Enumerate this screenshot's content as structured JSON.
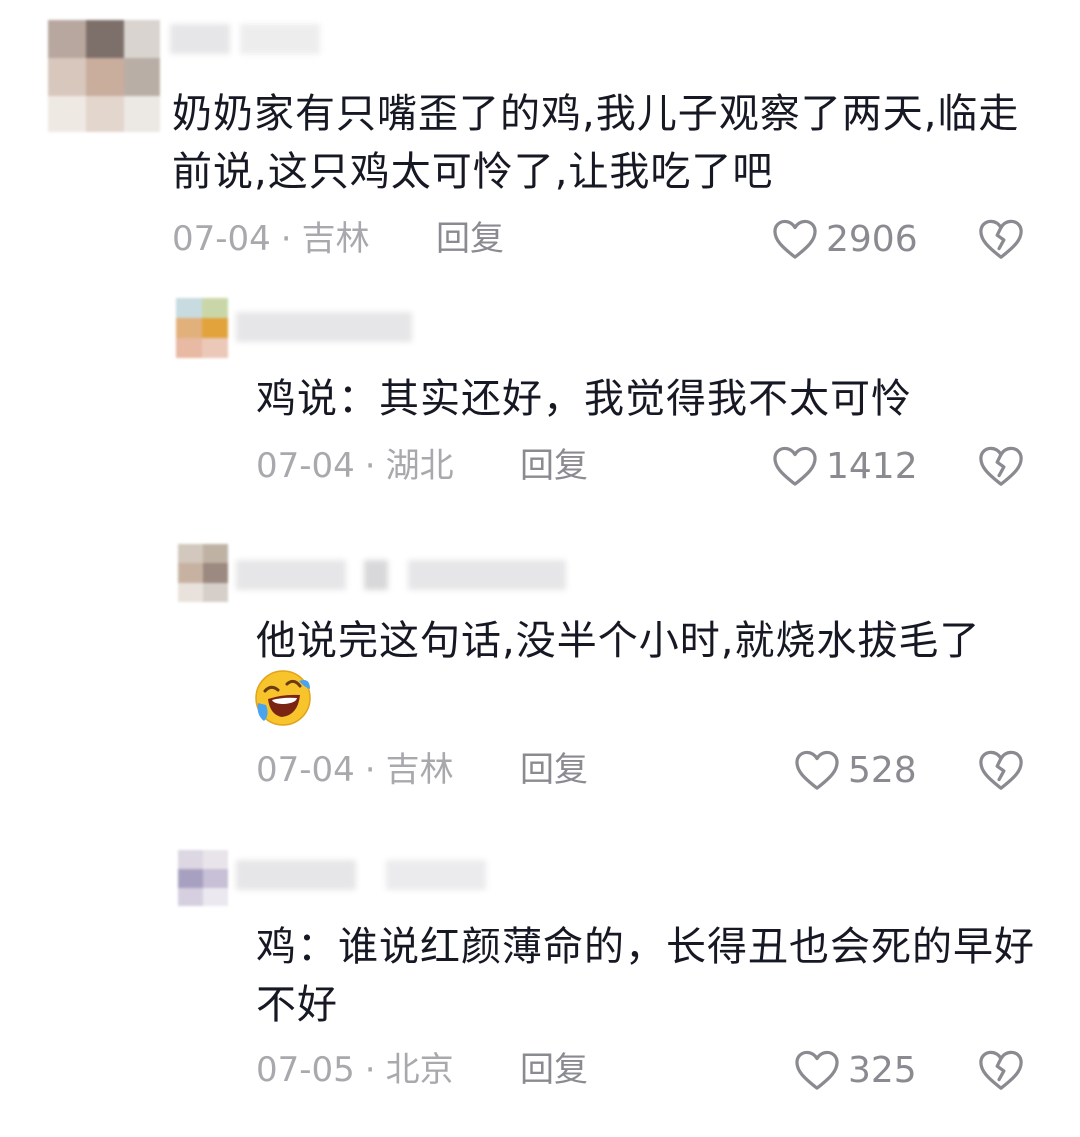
{
  "comments": [
    {
      "text": "奶奶家有只嘴歪了的鸡,我儿子观察了两天,临走前说,这只鸡太可怜了,让我吃了吧",
      "date": "07-04",
      "location": "吉林",
      "reply_label": "回复",
      "likes": "2906"
    },
    {
      "text": "鸡说：其实还好，我觉得我不太可怜",
      "date": "07-04",
      "location": "湖北",
      "reply_label": "回复",
      "likes": "1412"
    },
    {
      "text": "他说完这句话,没半个小时,就烧水拔毛了",
      "emoji": "laughing-crying-emoji",
      "date": "07-04",
      "location": "吉林",
      "reply_label": "回复",
      "likes": "528"
    },
    {
      "text": "鸡：谁说红颜薄命的，长得丑也会死的早好不好",
      "date": "07-05",
      "location": "北京",
      "reply_label": "回复",
      "likes": "325"
    }
  ],
  "meta_separator": "·",
  "icons": {
    "like": "heart-outline-icon",
    "dislike": "broken-heart-icon"
  },
  "colors": {
    "text": "#161823",
    "meta": "#a8a9ad",
    "icon": "#8a8b91"
  }
}
